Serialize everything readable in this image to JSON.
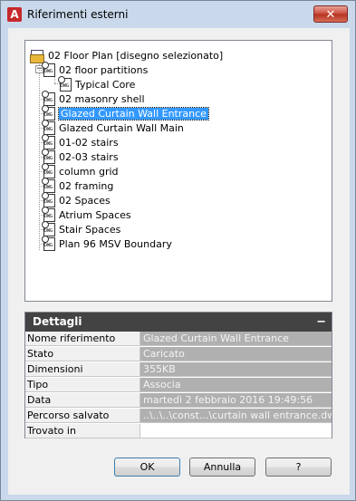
{
  "window": {
    "title": "Riferimenti esterni",
    "close_glyph": "✕",
    "app_icon_letter": "A"
  },
  "tree": {
    "root_label": "02 Floor Plan [disegno selezionato]",
    "items": [
      {
        "label": "02 floor partitions"
      },
      {
        "label": "Typical Core"
      },
      {
        "label": "02 masonry shell"
      },
      {
        "label": "Glazed Curtain Wall Entrance",
        "selected": true
      },
      {
        "label": "Glazed Curtain Wall Main"
      },
      {
        "label": "01-02 stairs"
      },
      {
        "label": "02-03 stairs"
      },
      {
        "label": "column grid"
      },
      {
        "label": "02 framing"
      },
      {
        "label": "02 Spaces"
      },
      {
        "label": "Atrium Spaces"
      },
      {
        "label": "Stair Spaces"
      },
      {
        "label": "Plan 96 MSV Boundary"
      }
    ],
    "expander_glyph": "−",
    "icon_text": "DWG"
  },
  "details": {
    "header": "Dettagli",
    "collapse_glyph": "−",
    "rows": [
      {
        "label": "Nome riferimento",
        "value": "Glazed Curtain Wall Entrance"
      },
      {
        "label": "Stato",
        "value": "Caricato"
      },
      {
        "label": "Dimensioni",
        "value": "355KB"
      },
      {
        "label": "Tipo",
        "value": "Associa"
      },
      {
        "label": "Data",
        "value": "martedì 2 febbraio 2016  19:49:56"
      },
      {
        "label": "Percorso salvato",
        "value": "..\\..\\..\\const...\\curtain wall entrance.dwg"
      },
      {
        "label": "Trovato in",
        "value": ""
      }
    ]
  },
  "buttons": {
    "ok": "OK",
    "cancel": "Annulla",
    "help": "?"
  }
}
